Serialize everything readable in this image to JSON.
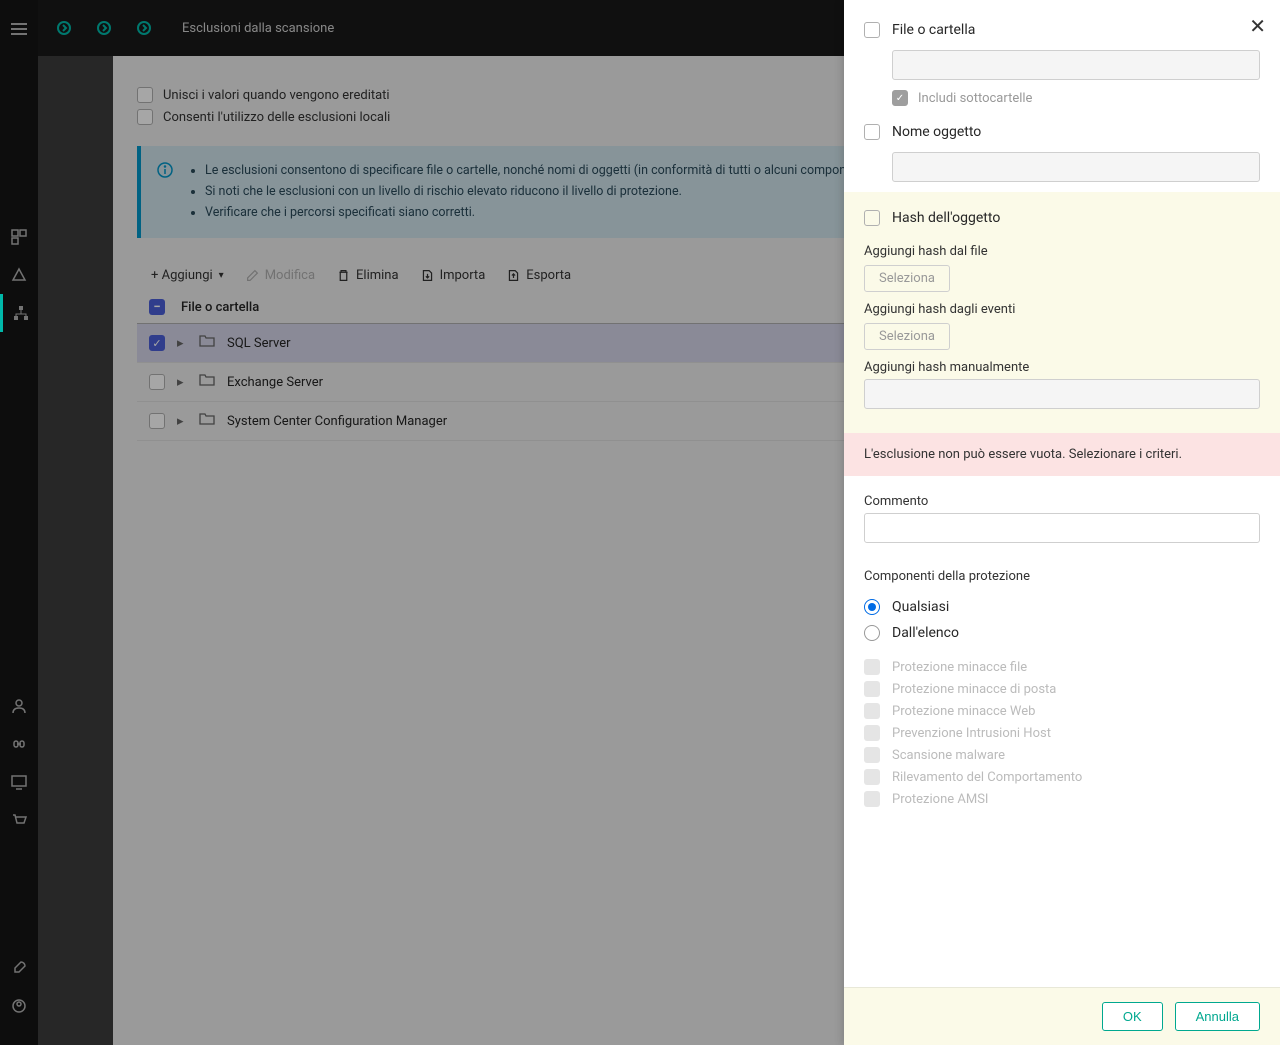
{
  "header": {
    "title": "Esclusioni dalla scansione"
  },
  "options": {
    "merge_inherit": "Unisci i valori quando vengono ereditati",
    "allow_local": "Consenti l'utilizzo delle esclusioni locali"
  },
  "info": {
    "line1": "Le esclusioni consentono di specificare file o cartelle, nonché nomi di oggetti (in conformità di tutti o alcuni componenti di Kaspersky Security for Virtualization Light Agent.",
    "line2": "Si noti che le esclusioni con un livello di rischio elevato riducono il livello di protezione.",
    "line3": "Verificare che i percorsi specificati siano corretti."
  },
  "toolbar": {
    "add": "+ Aggiungi",
    "edit": "Modifica",
    "delete": "Elimina",
    "import": "Importa",
    "export": "Esporta"
  },
  "table": {
    "header_col": "File o cartella",
    "rows": [
      "SQL Server",
      "Exchange Server",
      "System Center Configuration Manager"
    ]
  },
  "panel": {
    "file_or_folder": "File o cartella",
    "include_subfolders": "Includi sottocartelle",
    "object_name": "Nome oggetto",
    "object_hash": "Hash dell'oggetto",
    "add_hash_file": "Aggiungi hash dal file",
    "add_hash_events": "Aggiungi hash dagli eventi",
    "add_hash_manual": "Aggiungi hash manualmente",
    "select": "Seleziona",
    "error": "L'esclusione non può essere vuota. Selezionare i criteri.",
    "comment": "Commento",
    "components_title": "Componenti della protezione",
    "any": "Qualsiasi",
    "from_list": "Dall'elenco",
    "components": [
      "Protezione minacce file",
      "Protezione minacce di posta",
      "Protezione minacce Web",
      "Prevenzione Intrusioni Host",
      "Scansione malware",
      "Rilevamento del Comportamento",
      "Protezione AMSI"
    ],
    "ok": "OK",
    "cancel": "Annulla"
  }
}
